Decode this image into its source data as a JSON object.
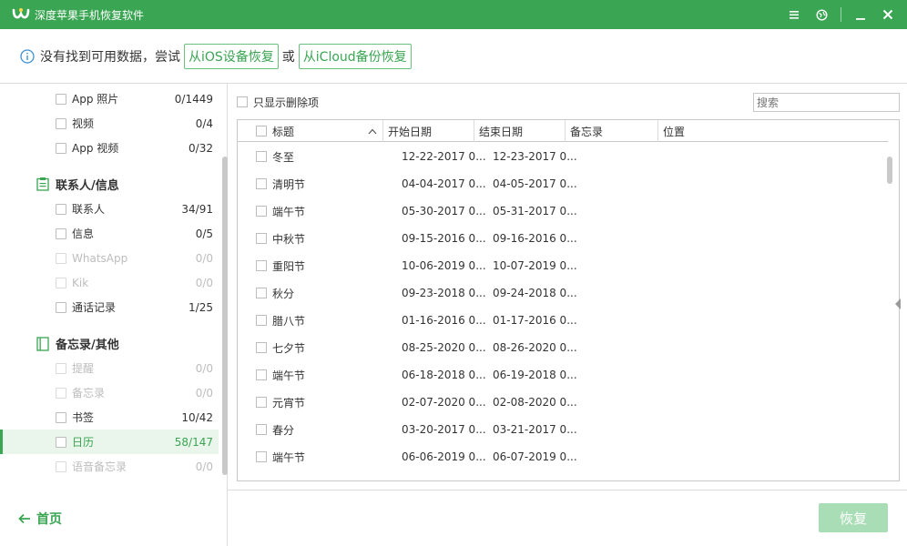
{
  "app": {
    "title": "深度苹果手机恢复软件"
  },
  "notice": {
    "text": "没有找到可用数据，尝试",
    "ios_button": "从iOS设备恢复",
    "or_text": "或",
    "icloud_button": "从iCloud备份恢复"
  },
  "sidebar": {
    "items_top": [
      {
        "label": "App 照片",
        "count": "0/1449",
        "disabled": false
      },
      {
        "label": "视频",
        "count": "0/4",
        "disabled": false
      },
      {
        "label": "App 视频",
        "count": "0/32",
        "disabled": false
      }
    ],
    "group_contacts": {
      "title": "联系人/信息",
      "items": [
        {
          "label": "联系人",
          "count": "34/91",
          "disabled": false
        },
        {
          "label": "信息",
          "count": "0/5",
          "disabled": false
        },
        {
          "label": "WhatsApp",
          "count": "0/0",
          "disabled": true
        },
        {
          "label": "Kik",
          "count": "0/0",
          "disabled": true
        },
        {
          "label": "通话记录",
          "count": "1/25",
          "disabled": false
        }
      ]
    },
    "group_notes": {
      "title": "备忘录/其他",
      "items": [
        {
          "label": "提醒",
          "count": "0/0",
          "disabled": true
        },
        {
          "label": "备忘录",
          "count": "0/0",
          "disabled": true
        },
        {
          "label": "书签",
          "count": "10/42",
          "disabled": false
        },
        {
          "label": "日历",
          "count": "58/147",
          "disabled": false,
          "active": true
        },
        {
          "label": "语音备忘录",
          "count": "0/0",
          "disabled": true
        }
      ]
    },
    "home_label": "首页"
  },
  "toolbar": {
    "show_deleted_label": "只显示删除项",
    "search_placeholder": "搜索"
  },
  "table": {
    "headers": {
      "title": "标题",
      "start": "开始日期",
      "end": "结束日期",
      "notes": "备忘录",
      "location": "位置"
    },
    "rows": [
      {
        "title": "冬至",
        "start": "12-22-2017 0...",
        "end": "12-23-2017 0..."
      },
      {
        "title": "清明节",
        "start": "04-04-2017 0...",
        "end": "04-05-2017 0..."
      },
      {
        "title": "端午节",
        "start": "05-30-2017 0...",
        "end": "05-31-2017 0..."
      },
      {
        "title": "中秋节",
        "start": "09-15-2016 0...",
        "end": "09-16-2016 0..."
      },
      {
        "title": "重阳节",
        "start": "10-06-2019 0...",
        "end": "10-07-2019 0..."
      },
      {
        "title": "秋分",
        "start": "09-23-2018 0...",
        "end": "09-24-2018 0..."
      },
      {
        "title": "腊八节",
        "start": "01-16-2016 0...",
        "end": "01-17-2016 0..."
      },
      {
        "title": "七夕节",
        "start": "08-25-2020 0...",
        "end": "08-26-2020 0..."
      },
      {
        "title": "端午节",
        "start": "06-18-2018 0...",
        "end": "06-19-2018 0..."
      },
      {
        "title": "元宵节",
        "start": "02-07-2020 0...",
        "end": "02-08-2020 0..."
      },
      {
        "title": "春分",
        "start": "03-20-2017 0...",
        "end": "03-21-2017 0..."
      },
      {
        "title": "端午节",
        "start": "06-06-2019 0...",
        "end": "06-07-2019 0..."
      }
    ]
  },
  "actions": {
    "recover_label": "恢复"
  },
  "colors": {
    "brand_green": "#3aa552",
    "disabled_button": "#a9ddb6"
  }
}
